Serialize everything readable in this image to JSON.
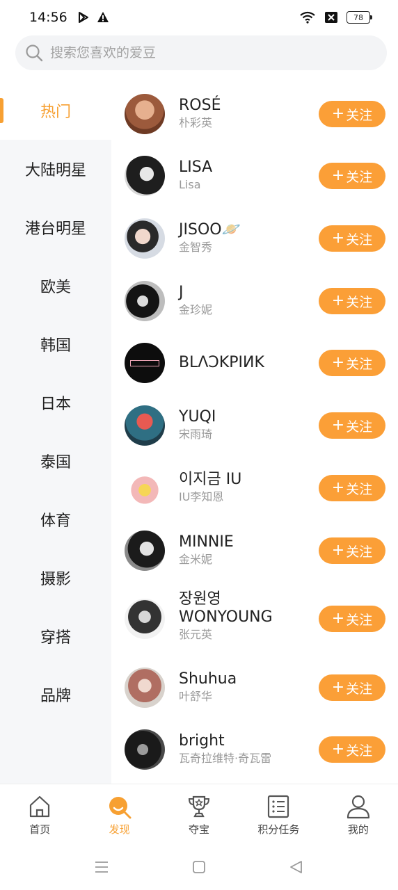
{
  "status_bar": {
    "time": "14:56",
    "battery": "78",
    "icons": [
      "play-store-icon",
      "alert-icon",
      "wifi-icon",
      "sim-x-icon",
      "battery-icon"
    ]
  },
  "search": {
    "placeholder": "搜索您喜欢的爱豆"
  },
  "categories": [
    {
      "label": "热门",
      "active": true
    },
    {
      "label": "大陆明星",
      "active": false
    },
    {
      "label": "港台明星",
      "active": false
    },
    {
      "label": "欧美",
      "active": false
    },
    {
      "label": "韩国",
      "active": false
    },
    {
      "label": "日本",
      "active": false
    },
    {
      "label": "泰国",
      "active": false
    },
    {
      "label": "体育",
      "active": false
    },
    {
      "label": "摄影",
      "active": false
    },
    {
      "label": "穿搭",
      "active": false
    },
    {
      "label": "品牌",
      "active": false
    }
  ],
  "follow_label": "关注",
  "idols": [
    {
      "name": "ROSÉ",
      "sub": "朴彩英",
      "avatar_color": "#b5704e"
    },
    {
      "name": "LISA",
      "sub": "Lisa",
      "avatar_color": "#3a3a3a"
    },
    {
      "name": "JISOO🪐",
      "sub": "金智秀",
      "avatar_color": "#c9ccd3"
    },
    {
      "name": "J",
      "sub": "金珍妮",
      "avatar_color": "#6d6d6d"
    },
    {
      "name": "BLΛƆKPIИK",
      "sub": "",
      "avatar_color": "#111111"
    },
    {
      "name": "YUQI",
      "sub": "宋雨琦",
      "avatar_color": "#2f6f83"
    },
    {
      "name": "이지금 IU",
      "sub": "IU李知恩",
      "avatar_color": "#f3e7b8"
    },
    {
      "name": "MINNIE",
      "sub": "金米妮",
      "avatar_color": "#444444"
    },
    {
      "name": "장원영\nWONYOUNG",
      "name_line1": "장원영",
      "name_line2": "WONYOUNG",
      "sub": "张元英",
      "avatar_color": "#8a8a8a"
    },
    {
      "name": "Shuhua",
      "sub": "叶舒华",
      "avatar_color": "#c8a79a"
    },
    {
      "name": "bright",
      "sub": "瓦奇拉维特·奇瓦雷",
      "avatar_color": "#2b2b2b"
    }
  ],
  "bottom_nav": [
    {
      "label": "首页",
      "icon": "home-icon",
      "active": false
    },
    {
      "label": "发现",
      "icon": "discover-icon",
      "active": true
    },
    {
      "label": "夺宝",
      "icon": "trophy-icon",
      "active": false
    },
    {
      "label": "积分任务",
      "icon": "task-list-icon",
      "active": false
    },
    {
      "label": "我的",
      "icon": "profile-icon",
      "active": false
    }
  ],
  "colors": {
    "accent": "#f7a032",
    "follow_button": "#fb9f37",
    "sidebar_bg": "#f6f7f9"
  }
}
